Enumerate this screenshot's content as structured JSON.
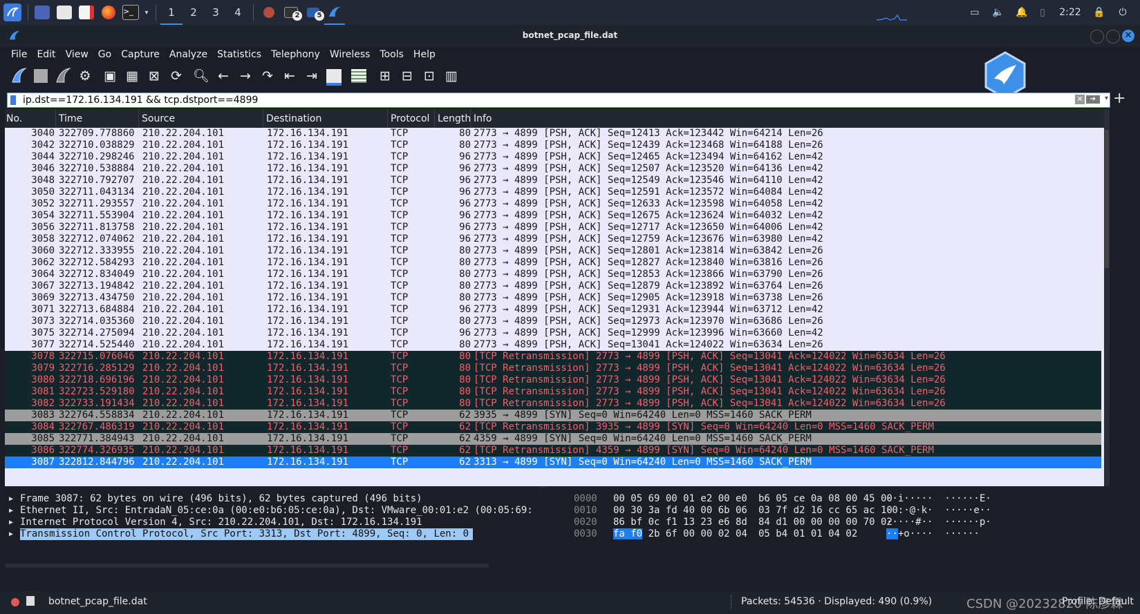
{
  "taskbar": {
    "workspaces": [
      "1",
      "2",
      "3",
      "4"
    ],
    "badge_a": "2",
    "badge_b": "5",
    "clock": "2:22"
  },
  "window": {
    "title": "botnet_pcap_file.dat"
  },
  "menu": [
    "File",
    "Edit",
    "View",
    "Go",
    "Capture",
    "Analyze",
    "Statistics",
    "Telephony",
    "Wireless",
    "Tools",
    "Help"
  ],
  "filter": {
    "value": "ip.dst==172.16.134.191 && tcp.dstport==4899"
  },
  "columns": [
    "No.",
    "Time",
    "Source",
    "Destination",
    "Protocol",
    "Length",
    "Info"
  ],
  "packets": [
    {
      "no": "3040",
      "time": "322709.778860",
      "src": "210.22.204.101",
      "dst": "172.16.134.191",
      "proto": "TCP",
      "len": "80",
      "info": "2773 → 4899 [PSH, ACK] Seq=12413 Ack=123442 Win=64214 Len=26",
      "style": "normal"
    },
    {
      "no": "3042",
      "time": "322710.038829",
      "src": "210.22.204.101",
      "dst": "172.16.134.191",
      "proto": "TCP",
      "len": "80",
      "info": "2773 → 4899 [PSH, ACK] Seq=12439 Ack=123468 Win=64188 Len=26",
      "style": "normal"
    },
    {
      "no": "3044",
      "time": "322710.298246",
      "src": "210.22.204.101",
      "dst": "172.16.134.191",
      "proto": "TCP",
      "len": "96",
      "info": "2773 → 4899 [PSH, ACK] Seq=12465 Ack=123494 Win=64162 Len=42",
      "style": "normal"
    },
    {
      "no": "3046",
      "time": "322710.538884",
      "src": "210.22.204.101",
      "dst": "172.16.134.191",
      "proto": "TCP",
      "len": "96",
      "info": "2773 → 4899 [PSH, ACK] Seq=12507 Ack=123520 Win=64136 Len=42",
      "style": "normal"
    },
    {
      "no": "3048",
      "time": "322710.792707",
      "src": "210.22.204.101",
      "dst": "172.16.134.191",
      "proto": "TCP",
      "len": "96",
      "info": "2773 → 4899 [PSH, ACK] Seq=12549 Ack=123546 Win=64110 Len=42",
      "style": "normal"
    },
    {
      "no": "3050",
      "time": "322711.043134",
      "src": "210.22.204.101",
      "dst": "172.16.134.191",
      "proto": "TCP",
      "len": "96",
      "info": "2773 → 4899 [PSH, ACK] Seq=12591 Ack=123572 Win=64084 Len=42",
      "style": "normal"
    },
    {
      "no": "3052",
      "time": "322711.293557",
      "src": "210.22.204.101",
      "dst": "172.16.134.191",
      "proto": "TCP",
      "len": "96",
      "info": "2773 → 4899 [PSH, ACK] Seq=12633 Ack=123598 Win=64058 Len=42",
      "style": "normal"
    },
    {
      "no": "3054",
      "time": "322711.553904",
      "src": "210.22.204.101",
      "dst": "172.16.134.191",
      "proto": "TCP",
      "len": "96",
      "info": "2773 → 4899 [PSH, ACK] Seq=12675 Ack=123624 Win=64032 Len=42",
      "style": "normal"
    },
    {
      "no": "3056",
      "time": "322711.813758",
      "src": "210.22.204.101",
      "dst": "172.16.134.191",
      "proto": "TCP",
      "len": "96",
      "info": "2773 → 4899 [PSH, ACK] Seq=12717 Ack=123650 Win=64006 Len=42",
      "style": "normal"
    },
    {
      "no": "3058",
      "time": "322712.074062",
      "src": "210.22.204.101",
      "dst": "172.16.134.191",
      "proto": "TCP",
      "len": "96",
      "info": "2773 → 4899 [PSH, ACK] Seq=12759 Ack=123676 Win=63980 Len=42",
      "style": "normal"
    },
    {
      "no": "3060",
      "time": "322712.333955",
      "src": "210.22.204.101",
      "dst": "172.16.134.191",
      "proto": "TCP",
      "len": "80",
      "info": "2773 → 4899 [PSH, ACK] Seq=12801 Ack=123814 Win=63842 Len=26",
      "style": "normal"
    },
    {
      "no": "3062",
      "time": "322712.584293",
      "src": "210.22.204.101",
      "dst": "172.16.134.191",
      "proto": "TCP",
      "len": "80",
      "info": "2773 → 4899 [PSH, ACK] Seq=12827 Ack=123840 Win=63816 Len=26",
      "style": "normal"
    },
    {
      "no": "3064",
      "time": "322712.834049",
      "src": "210.22.204.101",
      "dst": "172.16.134.191",
      "proto": "TCP",
      "len": "80",
      "info": "2773 → 4899 [PSH, ACK] Seq=12853 Ack=123866 Win=63790 Len=26",
      "style": "normal"
    },
    {
      "no": "3067",
      "time": "322713.194842",
      "src": "210.22.204.101",
      "dst": "172.16.134.191",
      "proto": "TCP",
      "len": "80",
      "info": "2773 → 4899 [PSH, ACK] Seq=12879 Ack=123892 Win=63764 Len=26",
      "style": "normal"
    },
    {
      "no": "3069",
      "time": "322713.434750",
      "src": "210.22.204.101",
      "dst": "172.16.134.191",
      "proto": "TCP",
      "len": "80",
      "info": "2773 → 4899 [PSH, ACK] Seq=12905 Ack=123918 Win=63738 Len=26",
      "style": "normal"
    },
    {
      "no": "3071",
      "time": "322713.684884",
      "src": "210.22.204.101",
      "dst": "172.16.134.191",
      "proto": "TCP",
      "len": "96",
      "info": "2773 → 4899 [PSH, ACK] Seq=12931 Ack=123944 Win=63712 Len=42",
      "style": "normal"
    },
    {
      "no": "3073",
      "time": "322714.035360",
      "src": "210.22.204.101",
      "dst": "172.16.134.191",
      "proto": "TCP",
      "len": "80",
      "info": "2773 → 4899 [PSH, ACK] Seq=12973 Ack=123970 Win=63686 Len=26",
      "style": "normal"
    },
    {
      "no": "3075",
      "time": "322714.275094",
      "src": "210.22.204.101",
      "dst": "172.16.134.191",
      "proto": "TCP",
      "len": "96",
      "info": "2773 → 4899 [PSH, ACK] Seq=12999 Ack=123996 Win=63660 Len=42",
      "style": "normal"
    },
    {
      "no": "3077",
      "time": "322714.525440",
      "src": "210.22.204.101",
      "dst": "172.16.134.191",
      "proto": "TCP",
      "len": "80",
      "info": "2773 → 4899 [PSH, ACK] Seq=13041 Ack=124022 Win=63634 Len=26",
      "style": "normal"
    },
    {
      "no": "3078",
      "time": "322715.076046",
      "src": "210.22.204.101",
      "dst": "172.16.134.191",
      "proto": "TCP",
      "len": "80",
      "info": "[TCP Retransmission] 2773 → 4899 [PSH, ACK] Seq=13041 Ack=124022 Win=63634 Len=26",
      "style": "bad"
    },
    {
      "no": "3079",
      "time": "322716.285129",
      "src": "210.22.204.101",
      "dst": "172.16.134.191",
      "proto": "TCP",
      "len": "80",
      "info": "[TCP Retransmission] 2773 → 4899 [PSH, ACK] Seq=13041 Ack=124022 Win=63634 Len=26",
      "style": "bad"
    },
    {
      "no": "3080",
      "time": "322718.696196",
      "src": "210.22.204.101",
      "dst": "172.16.134.191",
      "proto": "TCP",
      "len": "80",
      "info": "[TCP Retransmission] 2773 → 4899 [PSH, ACK] Seq=13041 Ack=124022 Win=63634 Len=26",
      "style": "bad"
    },
    {
      "no": "3081",
      "time": "322723.529180",
      "src": "210.22.204.101",
      "dst": "172.16.134.191",
      "proto": "TCP",
      "len": "80",
      "info": "[TCP Retransmission] 2773 → 4899 [PSH, ACK] Seq=13041 Ack=124022 Win=63634 Len=26",
      "style": "bad"
    },
    {
      "no": "3082",
      "time": "322733.191434",
      "src": "210.22.204.101",
      "dst": "172.16.134.191",
      "proto": "TCP",
      "len": "80",
      "info": "[TCP Retransmission] 2773 → 4899 [PSH, ACK] Seq=13041 Ack=124022 Win=63634 Len=26",
      "style": "bad"
    },
    {
      "no": "3083",
      "time": "322764.558834",
      "src": "210.22.204.101",
      "dst": "172.16.134.191",
      "proto": "TCP",
      "len": "62",
      "info": "3935 → 4899 [SYN] Seq=0 Win=64240 Len=0 MSS=1460 SACK_PERM",
      "style": "syn"
    },
    {
      "no": "3084",
      "time": "322767.486319",
      "src": "210.22.204.101",
      "dst": "172.16.134.191",
      "proto": "TCP",
      "len": "62",
      "info": "[TCP Retransmission] 3935 → 4899 [SYN] Seq=0 Win=64240 Len=0 MSS=1460 SACK_PERM",
      "style": "bad"
    },
    {
      "no": "3085",
      "time": "322771.384943",
      "src": "210.22.204.101",
      "dst": "172.16.134.191",
      "proto": "TCP",
      "len": "62",
      "info": "4359 → 4899 [SYN] Seq=0 Win=64240 Len=0 MSS=1460 SACK_PERM",
      "style": "syn"
    },
    {
      "no": "3086",
      "time": "322774.326935",
      "src": "210.22.204.101",
      "dst": "172.16.134.191",
      "proto": "TCP",
      "len": "62",
      "info": "[TCP Retransmission] 4359 → 4899 [SYN] Seq=0 Win=64240 Len=0 MSS=1460 SACK_PERM",
      "style": "bad"
    },
    {
      "no": "3087",
      "time": "322812.844796",
      "src": "210.22.204.101",
      "dst": "172.16.134.191",
      "proto": "TCP",
      "len": "62",
      "info": "3313 → 4899 [SYN] Seq=0 Win=64240 Len=0 MSS=1460 SACK_PERM",
      "style": "sel"
    }
  ],
  "details": [
    "Frame 3087: 62 bytes on wire (496 bits), 62 bytes captured (496 bits)",
    "Ethernet II, Src: EntradaN_05:ce:0a (00:e0:b6:05:ce:0a), Dst: VMware_00:01:e2 (00:05:69:",
    "Internet Protocol Version 4, Src: 210.22.204.101, Dst: 172.16.134.191",
    "Transmission Control Protocol, Src Port: 3313, Dst Port: 4899, Seq: 0, Len: 0"
  ],
  "bytes": [
    {
      "offset": "0000",
      "hex1": "00 05 69 00 01 e2 00 e0",
      "hex2": "b6 05 ce 0a 08 00 45 00",
      "ascii": "··i·····  ······E·"
    },
    {
      "offset": "0010",
      "hex1": "00 30 3a fd 40 00 6b 06",
      "hex2": "03 7f d2 16 cc 65 ac 10",
      "ascii": "·0:·@·k·  ·····e··"
    },
    {
      "offset": "0020",
      "hex1": "86 bf 0c f1 13 23 e6 8d",
      "hex2": "84 d1 00 00 00 00 70 02",
      "ascii": "·····#··  ······p·"
    },
    {
      "offset": "0030",
      "hex_hl": "fa f0",
      "hex1_rest": " 2b 6f 00 00 02 04",
      "hex2": "05 b4 01 01 04 02",
      "ascii_hl": "··",
      "ascii_rest": "+o····  ······"
    }
  ],
  "status": {
    "file": "botnet_pcap_file.dat",
    "packets": "Packets: 54536 · Displayed: 490 (0.9%)",
    "profile": "Profile: Default",
    "watermark": "CSDN @20232820 陈彦霖"
  }
}
